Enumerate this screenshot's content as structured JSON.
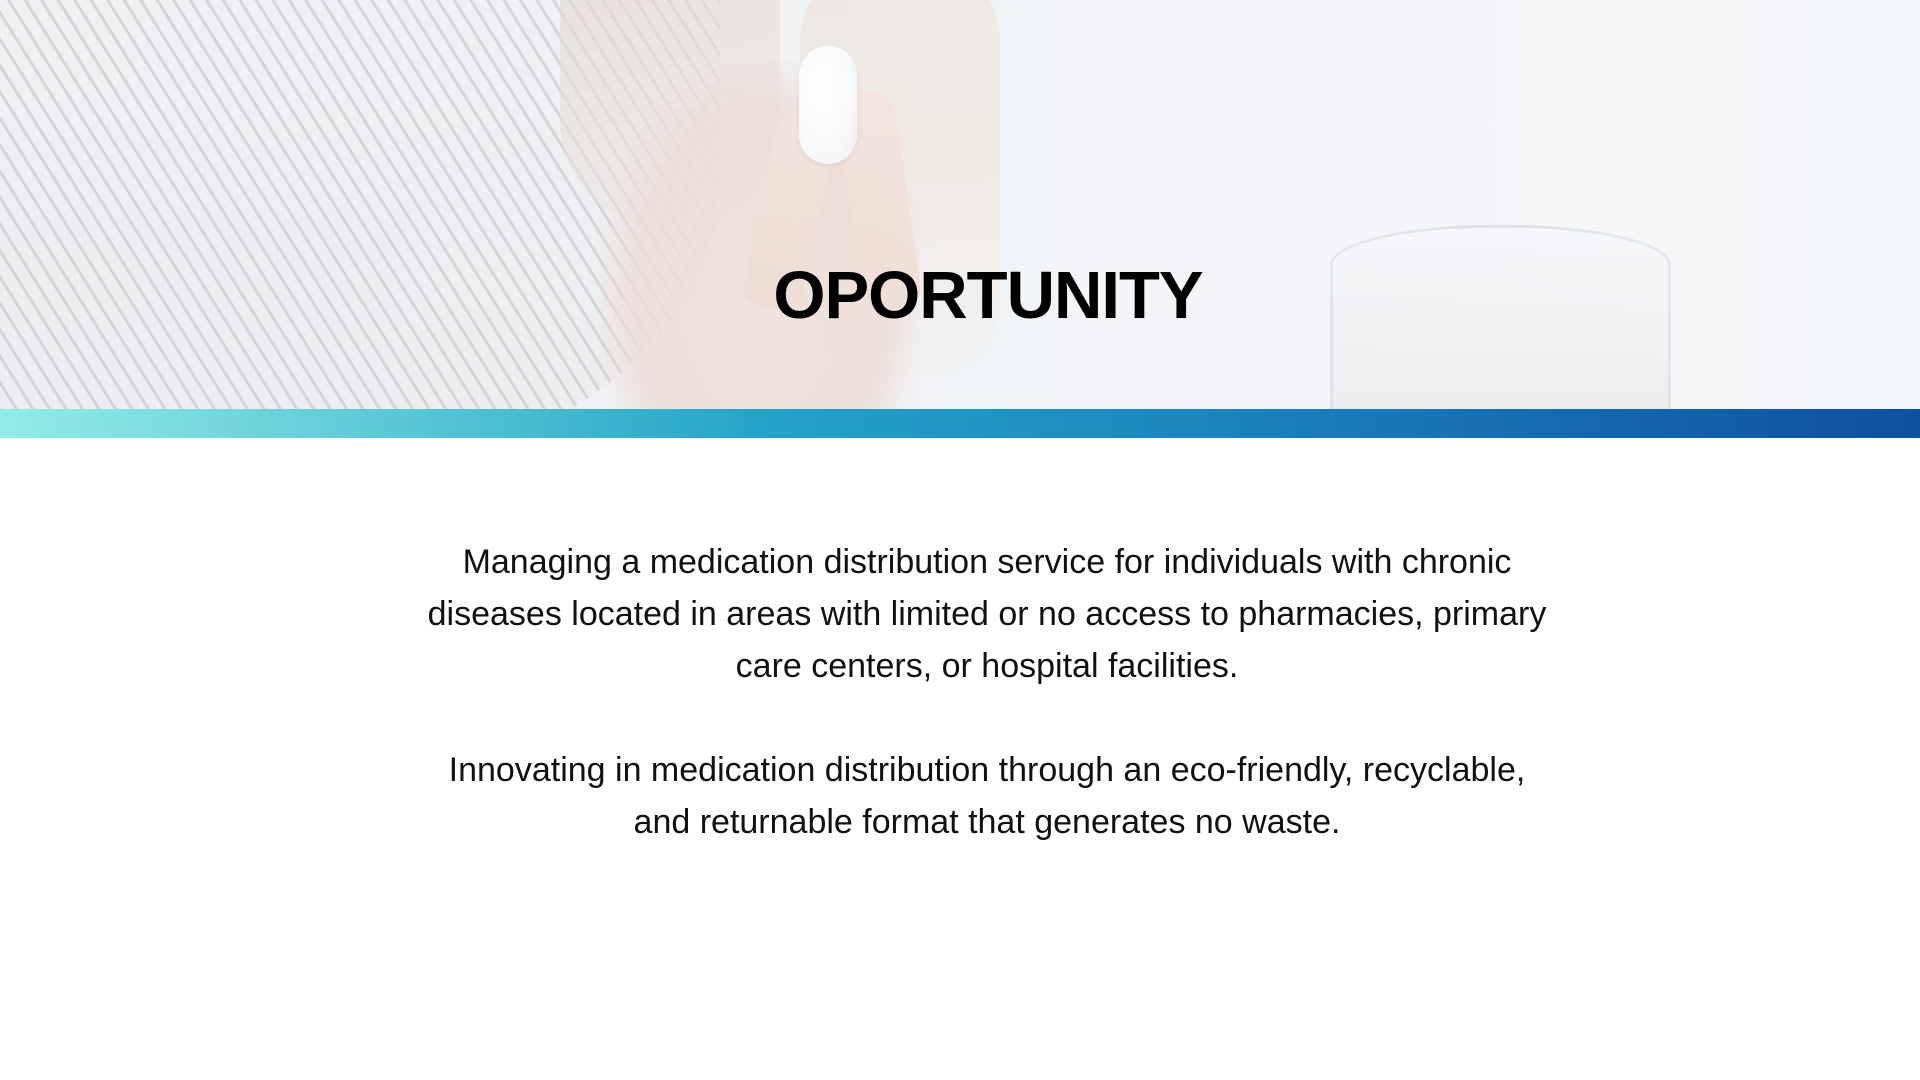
{
  "slide": {
    "title": "OPORTUNITY",
    "paragraphs": [
      "Managing a medication distribution service for individuals with chronic diseases located in areas with limited or no access to pharmacies, primary care centers, or hospital facilities.",
      "Innovating in medication distribution through an eco-friendly, recyclable, and returnable format that generates no waste."
    ],
    "accent_gradient": [
      "#93ece6",
      "#24a3c8",
      "#0f4f9e"
    ],
    "text_color": "#000000"
  }
}
